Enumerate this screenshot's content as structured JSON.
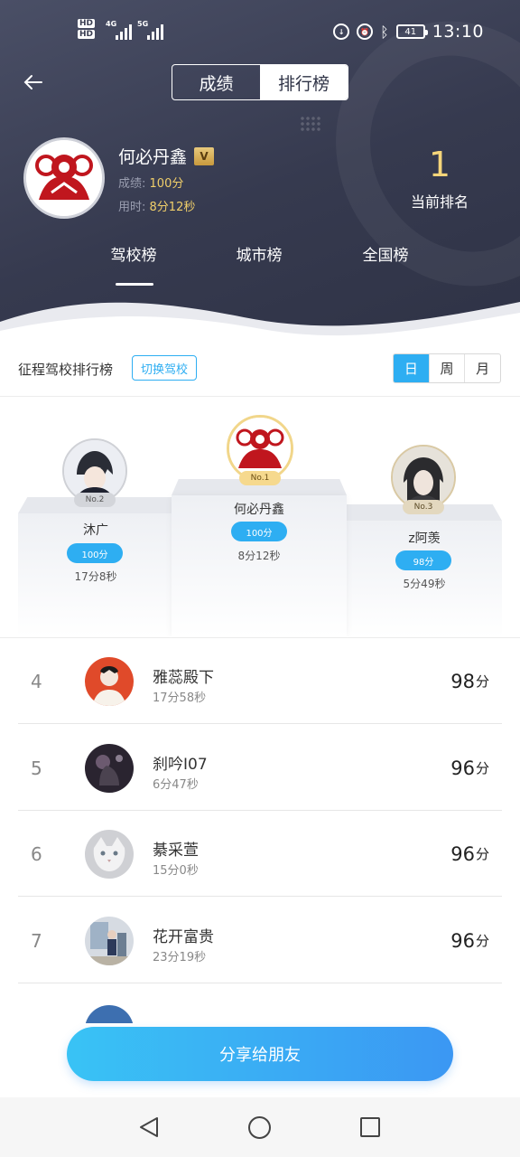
{
  "status_bar": {
    "hd1": "HD",
    "hd2": "HD",
    "net1": "4G",
    "net2": "5G",
    "battery": "41",
    "time": "13:10"
  },
  "header": {
    "tabs": [
      {
        "label": "成绩",
        "active": false
      },
      {
        "label": "排行榜",
        "active": true
      }
    ],
    "user": {
      "name": "何必丹鑫",
      "vip": "V",
      "score_label": "成绩:",
      "score": "100分",
      "time_label": "用时:",
      "time": "8分12秒"
    },
    "rank": {
      "value": "1",
      "label": "当前排名"
    },
    "board_tabs": [
      {
        "label": "驾校榜",
        "active": true
      },
      {
        "label": "城市榜",
        "active": false
      },
      {
        "label": "全国榜",
        "active": false
      }
    ]
  },
  "leaderboard": {
    "title": "征程驾校排行榜",
    "switch_label": "切换驾校",
    "periods": [
      {
        "label": "日",
        "active": true
      },
      {
        "label": "周",
        "active": false
      },
      {
        "label": "月",
        "active": false
      }
    ]
  },
  "podium": {
    "first": {
      "badge": "No.1",
      "name": "何必丹鑫",
      "score": "100分",
      "time": "8分12秒"
    },
    "second": {
      "badge": "No.2",
      "name": "沐广",
      "score": "100分",
      "time": "17分8秒"
    },
    "third": {
      "badge": "No.3",
      "name": "z阿羡",
      "score": "98分",
      "time": "5分49秒"
    }
  },
  "list": [
    {
      "rank": "4",
      "name": "雅蕊殿下",
      "time": "17分58秒",
      "score": "98",
      "unit": "分"
    },
    {
      "rank": "5",
      "name": "刹吟I07",
      "time": "6分47秒",
      "score": "96",
      "unit": "分"
    },
    {
      "rank": "6",
      "name": "綦采萱",
      "time": "15分0秒",
      "score": "96",
      "unit": "分"
    },
    {
      "rank": "7",
      "name": "花开富贵",
      "time": "23分19秒",
      "score": "96",
      "unit": "分"
    }
  ],
  "share_button": "分享给朋友",
  "colors": {
    "accent": "#2eaef2",
    "header_bg": "#363a4f",
    "gold": "#f5d57a"
  }
}
